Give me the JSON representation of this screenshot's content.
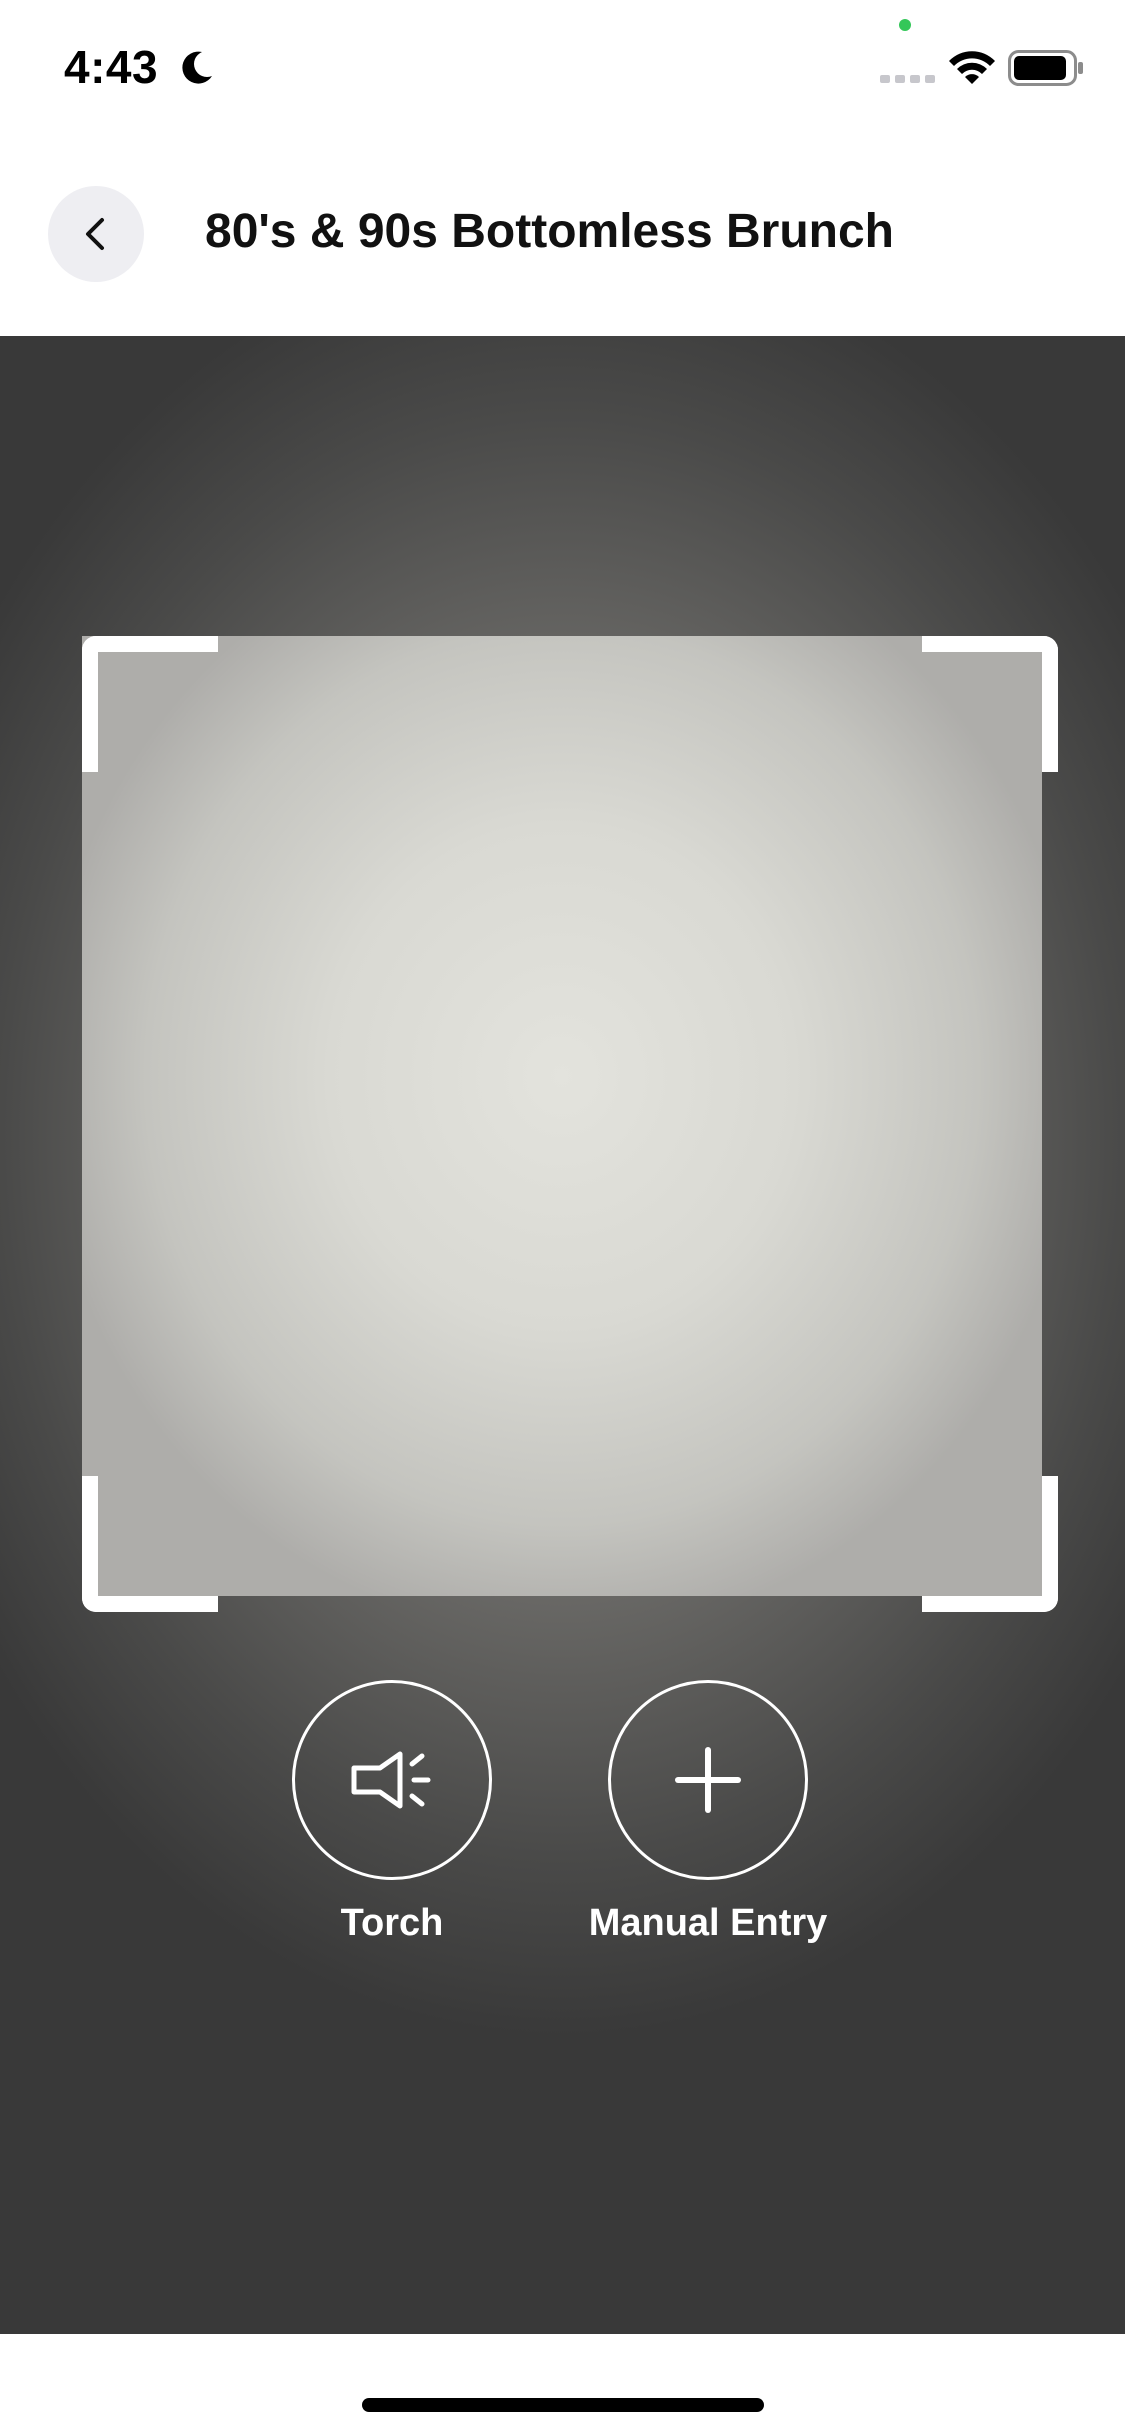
{
  "status_bar": {
    "time": "4:43",
    "focus_icon": "moon-icon",
    "indicator_color": "#34c759",
    "icons": [
      "cell-signal-icon",
      "wifi-icon",
      "battery-icon"
    ]
  },
  "header": {
    "back_icon": "chevron-left-icon",
    "title": "80's & 90s Bottomless Brunch"
  },
  "scanner": {
    "actions": [
      {
        "label": "Torch",
        "icon": "torch-icon"
      },
      {
        "label": "Manual Entry",
        "icon": "plus-icon"
      }
    ]
  },
  "colors": {
    "accent_white": "#ffffff",
    "back_button_bg": "#eeeef2"
  }
}
